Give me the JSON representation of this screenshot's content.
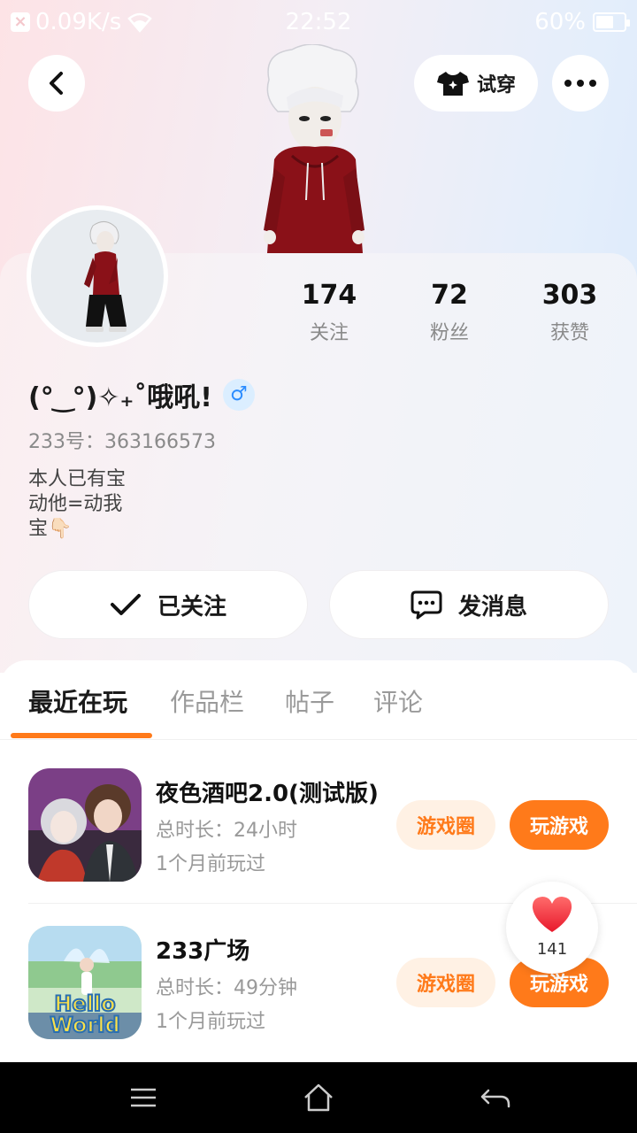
{
  "status_bar": {
    "net_speed": "0.09K/s",
    "time": "22:52",
    "battery": "60%",
    "battery_level": 0.6
  },
  "header": {
    "try_on_label": "试穿"
  },
  "profile": {
    "stats": [
      {
        "value": "174",
        "label": "关注"
      },
      {
        "value": "72",
        "label": "粉丝"
      },
      {
        "value": "303",
        "label": "获赞"
      }
    ],
    "nickname": "(° ͜ °)✧₊˚哦吼!",
    "gender_symbol": "♂",
    "id_text": "233号：363166573",
    "bio_lines": [
      "本人已有宝",
      "动他=动我",
      "宝👇🏻"
    ]
  },
  "actions": {
    "followed_label": "已关注",
    "message_label": "发消息"
  },
  "tabs": [
    {
      "label": "最近在玩",
      "active": true
    },
    {
      "label": "作品栏",
      "active": false
    },
    {
      "label": "帖子",
      "active": false
    },
    {
      "label": "评论",
      "active": false
    }
  ],
  "games": [
    {
      "title": "夜色酒吧2.0(测试版)",
      "duration": "总时长：24小时",
      "last_played": "1个月前玩过",
      "circle_label": "游戏圈",
      "play_label": "玩游戏"
    },
    {
      "title": "233广场",
      "duration": "总时长：49分钟",
      "last_played": "1个月前玩过",
      "circle_label": "游戏圈",
      "play_label": "玩游戏",
      "icon_text_1": "Hello",
      "icon_text_2": "World"
    }
  ],
  "like_float": {
    "count": "141"
  },
  "colors": {
    "accent": "#ff7a1a",
    "accent_light": "#fff1e4",
    "gender_blue": "#2b8cff"
  }
}
